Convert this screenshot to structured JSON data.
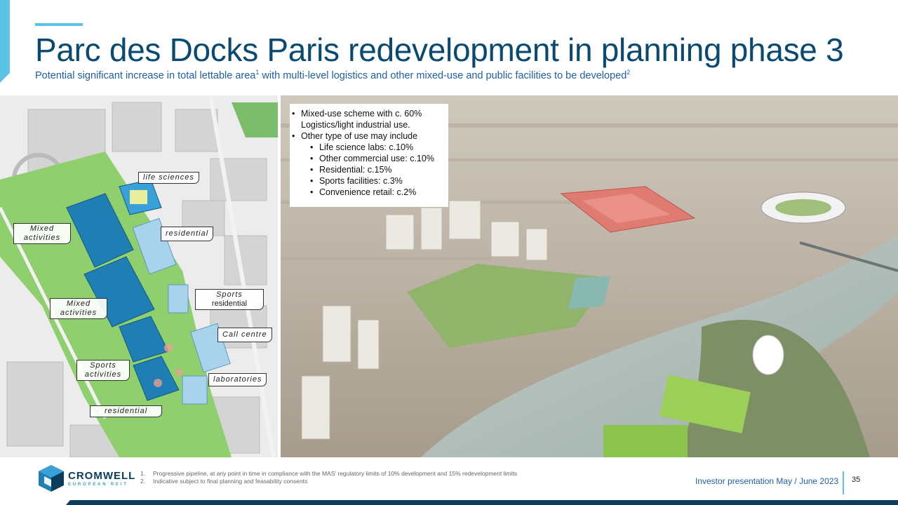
{
  "slide": {
    "title": "Parc des Docks Paris redevelopment in planning phase 3",
    "subtitle_part1": "Potential significant increase in total lettable area",
    "subtitle_sup1": "1",
    "subtitle_part2": " with multi-level logistics and other mixed-use and public facilities to be developed",
    "subtitle_sup2": "2"
  },
  "plan_labels": [
    {
      "text": "life sciences"
    },
    {
      "text": "Mixed activities"
    },
    {
      "text": "residential"
    },
    {
      "text": "Sports"
    },
    {
      "text": "residential"
    },
    {
      "text": "Mixed activities"
    },
    {
      "text": "Call centre"
    },
    {
      "text": "Sports activities"
    },
    {
      "text": "laboratories"
    },
    {
      "text": "residential"
    }
  ],
  "info_box": {
    "items": [
      "Mixed-use scheme with c. 60% Logistics/light industrial use.",
      "Other type of use may include"
    ],
    "subitems": [
      "Life science labs: c.10%",
      "Other commercial use: c.10%",
      "Residential: c.15%",
      "Sports facilities: c.3%",
      "Convenience retail: c.2%"
    ]
  },
  "footer": {
    "brand": "CROMWELL",
    "brand_sub": "EUROPEAN REIT",
    "footnotes": [
      {
        "num": "1.",
        "text": "Progressive pipeline, at any point in time in compliance with the MAS' regulatory limits of 10% development and 15% redevelopment limits"
      },
      {
        "num": "2.",
        "text": "Indicative subject to final planning and feasability consents"
      }
    ],
    "presentation": "Investor presentation May / June 2023",
    "page_number": "35"
  },
  "colors": {
    "title": "#0a4a72",
    "subtitle": "#1f5fa8",
    "accent": "#5cc3e6",
    "dark_bar": "#0a3d5c",
    "plan_blue": "#1f7fb5",
    "plan_green": "#7cc36a",
    "logistics_red": "#e0605a"
  },
  "icons": {
    "logo": "cromwell-cube-icon"
  }
}
